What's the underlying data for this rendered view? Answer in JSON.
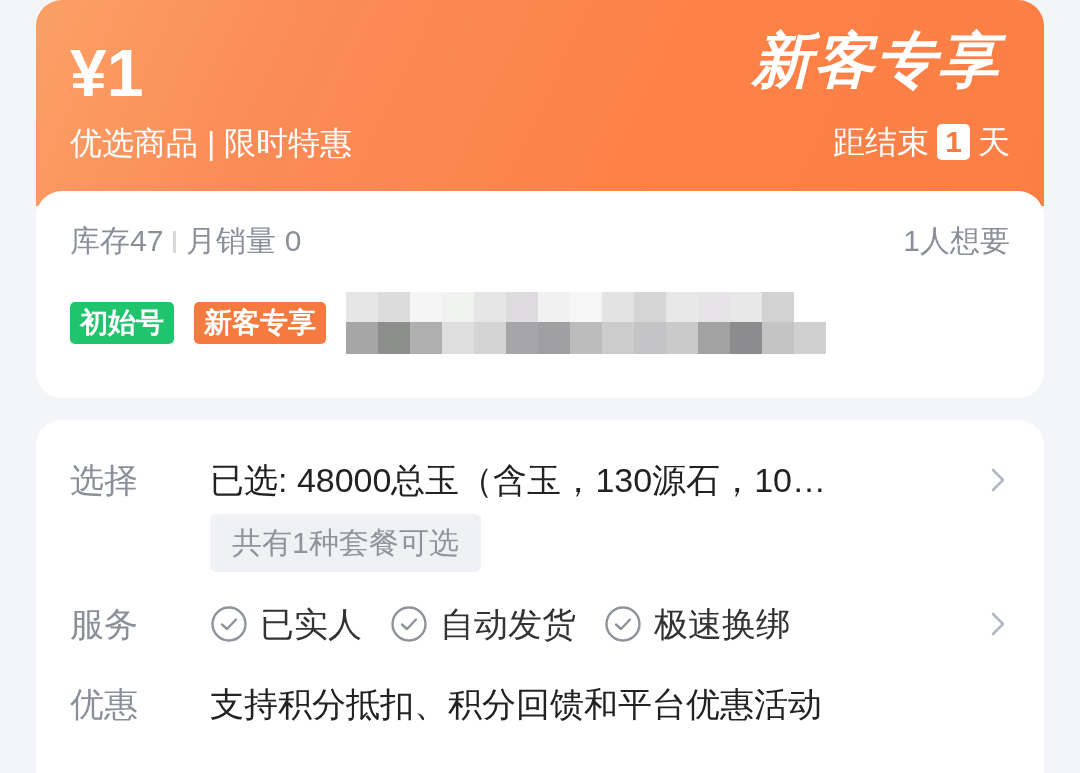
{
  "banner": {
    "price": "¥1",
    "subtitle": "优选商品 | 限时特惠",
    "title": "新客专享",
    "countdown_prefix": "距结束",
    "countdown_value": "1",
    "countdown_suffix": "天"
  },
  "stats": {
    "stock": "库存47",
    "monthly_sales": "月销量 0",
    "wants": "1人想要"
  },
  "tags": [
    {
      "label": "初始号",
      "color": "#1fc46c"
    },
    {
      "label": "新客专享",
      "color": "#f57a3f"
    }
  ],
  "details": {
    "select_label": "选择",
    "selected": "已选: 48000总玉（含玉，130源石，10…",
    "options_hint": "共有1种套餐可选",
    "service_label": "服务",
    "services": [
      "已实人",
      "自动发货",
      "极速换绑"
    ],
    "discount_label": "优惠",
    "discount": "支持积分抵扣、积分回馈和平台优惠活动"
  }
}
